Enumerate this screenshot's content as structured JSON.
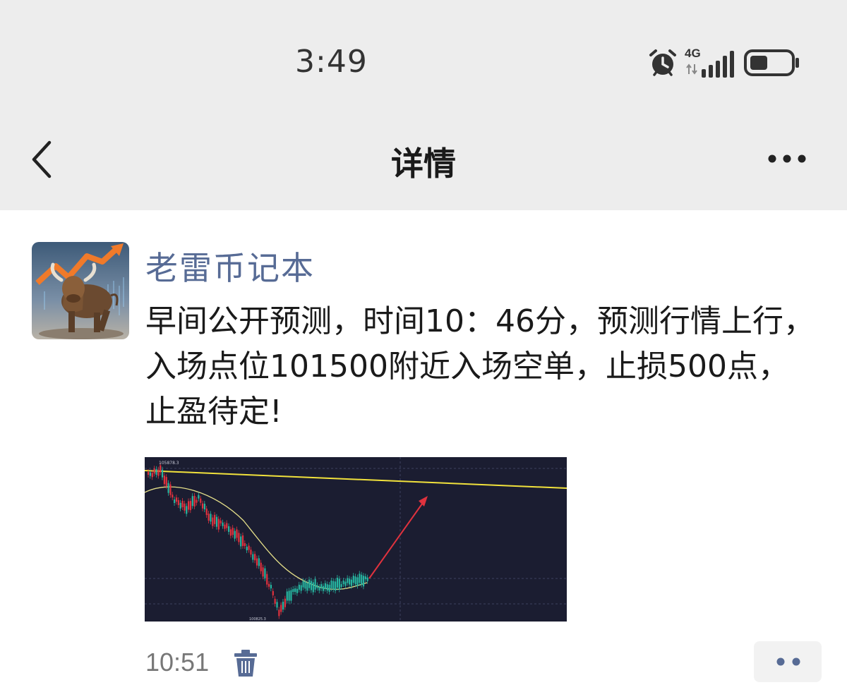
{
  "status_bar": {
    "time": "3:49",
    "network": "4G",
    "icons": [
      "alarm-icon",
      "signal-icon",
      "battery-icon"
    ]
  },
  "nav": {
    "title": "详情",
    "back_icon": "chevron-left-icon",
    "more_icon": "more-dots-icon"
  },
  "post": {
    "author": "老雷币记本",
    "text": "早间公开预测，时间10：46分，预测行情上行，入场点位101500附近入场空单，止损500点，止盈待定!",
    "image": {
      "high_label": "105878.3",
      "low_label": "100825.3"
    },
    "time": "10:51",
    "delete_icon": "trash-icon",
    "action_icon": "two-dots-icon"
  },
  "colors": {
    "link": "#576b95",
    "header_bg": "#ededed",
    "chart_bg": "#1b1d31",
    "candle_down": "#e0323e",
    "candle_up": "#26b5a0",
    "trendline": "#f2e23c",
    "arrow": "#e0323e"
  }
}
